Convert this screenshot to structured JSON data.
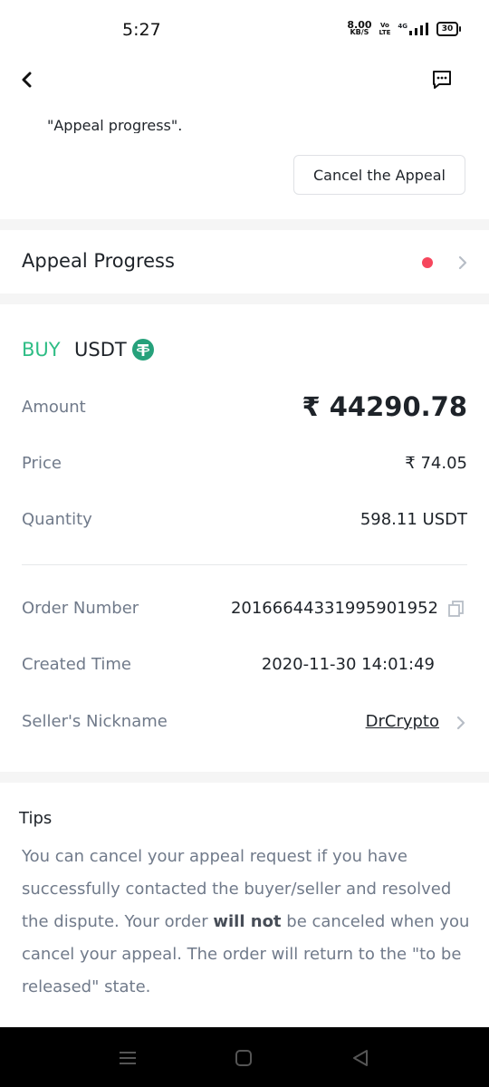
{
  "status_bar": {
    "time": "5:27",
    "net_speed_value": "8.00",
    "net_speed_unit": "KB/S",
    "volte_top": "Vo",
    "volte_bottom": "LTE",
    "network": "4G",
    "battery": "30"
  },
  "header": {
    "back_icon": "chevron-left-icon",
    "chat_icon": "chat-bubble-icon"
  },
  "appeal_note": "\"Appeal progress\".",
  "cancel_button_label": "Cancel the Appeal",
  "appeal_progress": {
    "label": "Appeal Progress",
    "indicator_color": "#f6465d"
  },
  "order": {
    "side": "BUY",
    "asset": "USDT",
    "side_color": "#2ebd85",
    "asset_icon": "tether-icon",
    "amount_label": "Amount",
    "amount_value": "₹ 44290.78",
    "price_label": "Price",
    "price_value": "₹ 74.05",
    "quantity_label": "Quantity",
    "quantity_value": "598.11 USDT",
    "order_number_label": "Order Number",
    "order_number_value": "20166644331995901952",
    "created_time_label": "Created Time",
    "created_time_value": "2020-11-30 14:01:49",
    "seller_label": "Seller's Nickname",
    "seller_value": "DrCrypto"
  },
  "tips": {
    "title": "Tips",
    "text_before": "You can cancel your appeal request if you have successfully contacted the buyer/seller and resolved the dispute. Your order ",
    "text_bold": "will not",
    "text_after": " be canceled when you cancel your appeal. The order will return to the \"to be released\" state."
  },
  "system_nav": {
    "menu_icon": "menu-icon",
    "home_icon": "home-square-icon",
    "back_icon": "back-triangle-icon"
  }
}
